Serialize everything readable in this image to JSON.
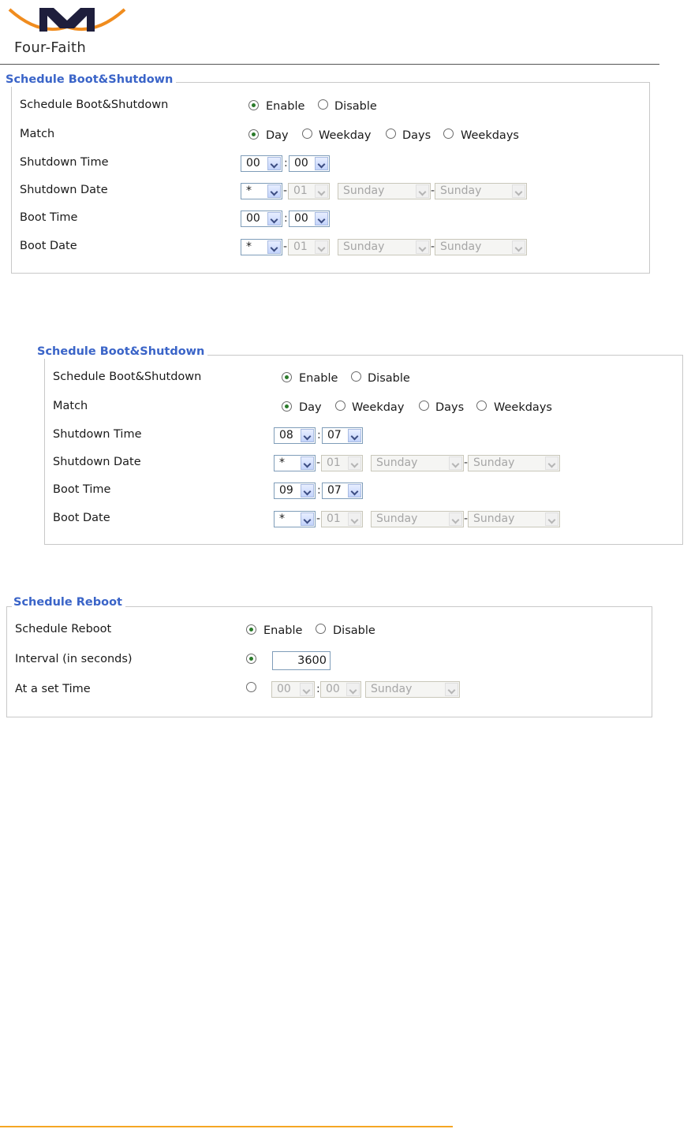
{
  "logo": {
    "text": "Four-Faith"
  },
  "panel1": {
    "legend": "Schedule Boot&Shutdown",
    "rows": {
      "schedule": {
        "label": "Schedule Boot&Shutdown",
        "enable": "Enable",
        "disable": "Disable",
        "selected": "Enable"
      },
      "match": {
        "label": "Match",
        "options": [
          "Day",
          "Weekday",
          "Days",
          "Weekdays"
        ],
        "selected": "Day"
      },
      "shutdown_time": {
        "label": "Shutdown Time",
        "hour": "00",
        "minute": "00"
      },
      "shutdown_date": {
        "label": "Shutdown Date",
        "month": "*",
        "day": "01",
        "weekday_from": "Sunday",
        "weekday_to": "Sunday"
      },
      "boot_time": {
        "label": "Boot Time",
        "hour": "00",
        "minute": "00"
      },
      "boot_date": {
        "label": "Boot Date",
        "month": "*",
        "day": "01",
        "weekday_from": "Sunday",
        "weekday_to": "Sunday"
      }
    }
  },
  "panel2": {
    "legend": "Schedule Boot&Shutdown",
    "rows": {
      "schedule": {
        "label": "Schedule Boot&Shutdown",
        "enable": "Enable",
        "disable": "Disable",
        "selected": "Enable"
      },
      "match": {
        "label": "Match",
        "options": [
          "Day",
          "Weekday",
          "Days",
          "Weekdays"
        ],
        "selected": "Day"
      },
      "shutdown_time": {
        "label": "Shutdown Time",
        "hour": "08",
        "minute": "07"
      },
      "shutdown_date": {
        "label": "Shutdown Date",
        "month": "*",
        "day": "01",
        "weekday_from": "Sunday",
        "weekday_to": "Sunday"
      },
      "boot_time": {
        "label": "Boot Time",
        "hour": "09",
        "minute": "07"
      },
      "boot_date": {
        "label": "Boot Date",
        "month": "*",
        "day": "01",
        "weekday_from": "Sunday",
        "weekday_to": "Sunday"
      }
    }
  },
  "panel3": {
    "legend": "Schedule Reboot",
    "rows": {
      "reboot": {
        "label": "Schedule Reboot",
        "enable": "Enable",
        "disable": "Disable",
        "selected": "Enable"
      },
      "interval": {
        "label": "Interval (in seconds)",
        "value": "3600",
        "selected": true
      },
      "set_time": {
        "label": "At a set Time",
        "hour": "00",
        "minute": "00",
        "weekday": "Sunday",
        "selected": false
      }
    }
  },
  "colors": {
    "legend": "#3a64c8",
    "logo_arc": "#f08c1e",
    "footer_rule": "#f5a623",
    "radio_dot": "#2a7a2a"
  },
  "icons": [
    "logo-m-icon",
    "chevron-down-icon",
    "radio-icon"
  ]
}
